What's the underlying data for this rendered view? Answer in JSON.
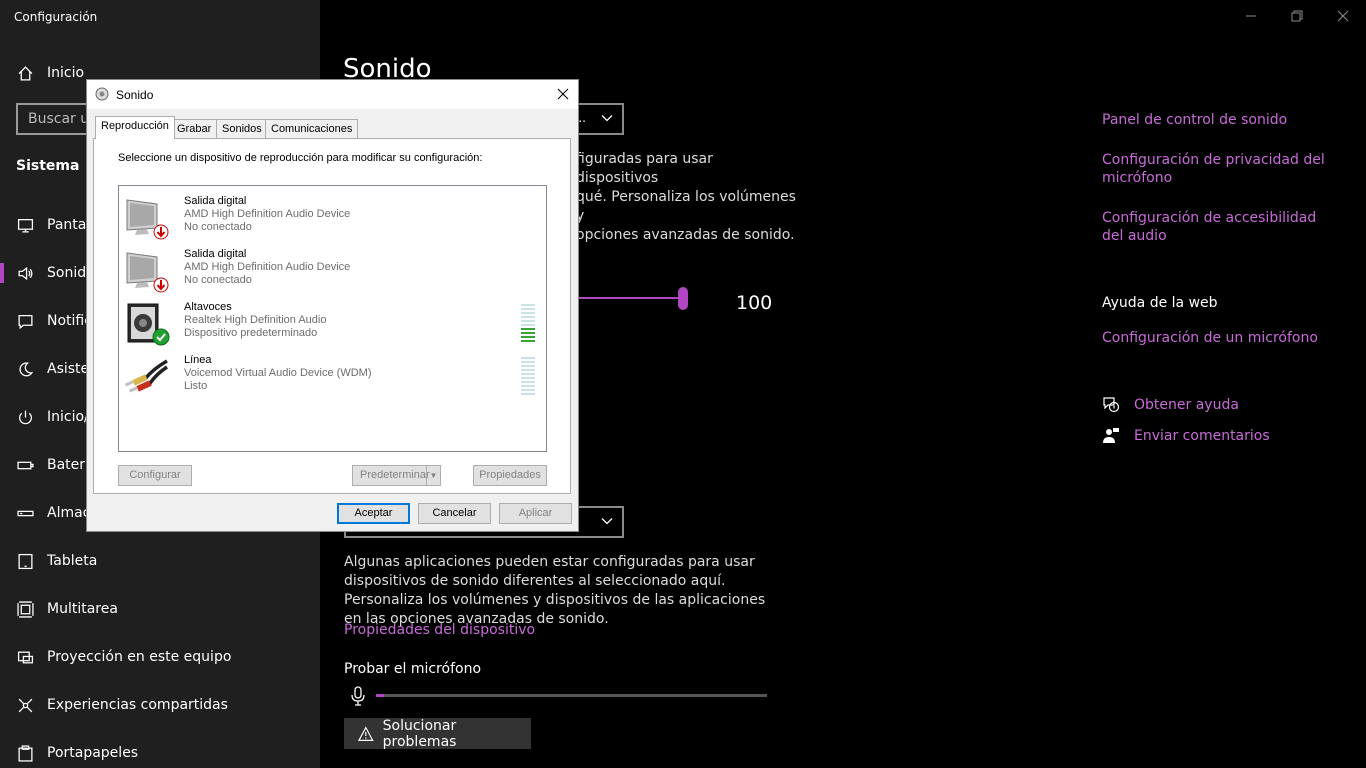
{
  "window": {
    "title": "Configuración"
  },
  "sidebar": {
    "home_label": "Inicio",
    "search_placeholder": "Buscar un",
    "section_title": "Sistema",
    "items": [
      {
        "label": "Pantalla",
        "icon": "monitor-icon"
      },
      {
        "label": "Sonido",
        "icon": "speaker-icon",
        "selected": true
      },
      {
        "label": "Notificaciones",
        "icon": "notification-icon"
      },
      {
        "label": "Asistente",
        "icon": "moon-icon"
      },
      {
        "label": "Inicio/apagado",
        "icon": "power-icon"
      },
      {
        "label": "Batería",
        "icon": "battery-icon"
      },
      {
        "label": "Almacenamiento",
        "icon": "storage-icon"
      },
      {
        "label": "Tableta",
        "icon": "tablet-icon"
      },
      {
        "label": "Multitarea",
        "icon": "multitask-icon"
      },
      {
        "label": "Proyección en este equipo",
        "icon": "projection-icon"
      },
      {
        "label": "Experiencias compartidas",
        "icon": "shared-icon"
      },
      {
        "label": "Portapapeles",
        "icon": "clipboard-icon"
      }
    ]
  },
  "main": {
    "page_title": "Sonido",
    "output_combo_value": "...",
    "output_desc": "figuradas para usar dispositivos\nqué. Personaliza los volúmenes y\nopciones avanzadas de sonido.",
    "volume_value": "100",
    "volume_percent": 100,
    "input_desc": "Algunas aplicaciones pueden estar configuradas para usar dispositivos de sonido diferentes al seleccionado aquí. Personaliza los volúmenes y dispositivos de las aplicaciones en las opciones avanzadas de sonido.",
    "device_properties": "Propiedades del dispositivo",
    "mic_test_title": "Probar el micrófono",
    "mic_level_percent": 2,
    "troubleshoot_label": "Solucionar problemas"
  },
  "related": {
    "links": [
      "Panel de control de sonido",
      "Configuración de privacidad del micrófono",
      "Configuración de accesibilidad del audio"
    ],
    "help_title": "Ayuda de la web",
    "help_link": "Configuración de un micrófono",
    "get_help": "Obtener ayuda",
    "feedback": "Enviar comentarios"
  },
  "dialog": {
    "title": "Sonido",
    "tabs": [
      "Reproducción",
      "Grabar",
      "Sonidos",
      "Comunicaciones"
    ],
    "instruction": "Seleccione un dispositivo de reproducción para modificar su configuración:",
    "devices": [
      {
        "name": "Salida digital",
        "driver": "AMD High Definition Audio Device",
        "status": "No conectado",
        "icon": "monitor-speaker-icon",
        "badge": "disconnected-badge-icon"
      },
      {
        "name": "Salida digital",
        "driver": "AMD High Definition Audio Device",
        "status": "No conectado",
        "icon": "monitor-speaker-icon",
        "badge": "disconnected-badge-icon"
      },
      {
        "name": "Altavoces",
        "driver": "Realtek High Definition Audio",
        "status": "Dispositivo predeterminado",
        "icon": "speaker-box-icon",
        "badge": "default-check-icon",
        "level_bars": 4
      },
      {
        "name": "Línea",
        "driver": "Voicemod Virtual Audio Device (WDM)",
        "status": "Listo",
        "icon": "rca-cable-icon",
        "level_bars": 0
      }
    ],
    "buttons": {
      "configure": "Configurar",
      "set_default": "Predeterminar",
      "properties": "Propiedades",
      "ok": "Aceptar",
      "cancel": "Cancelar",
      "apply": "Aplicar"
    }
  },
  "colors": {
    "accent": "#b146c2",
    "link": "#c86bd8",
    "sidebar_bg": "#1f1f1f",
    "main_bg": "#000000"
  }
}
